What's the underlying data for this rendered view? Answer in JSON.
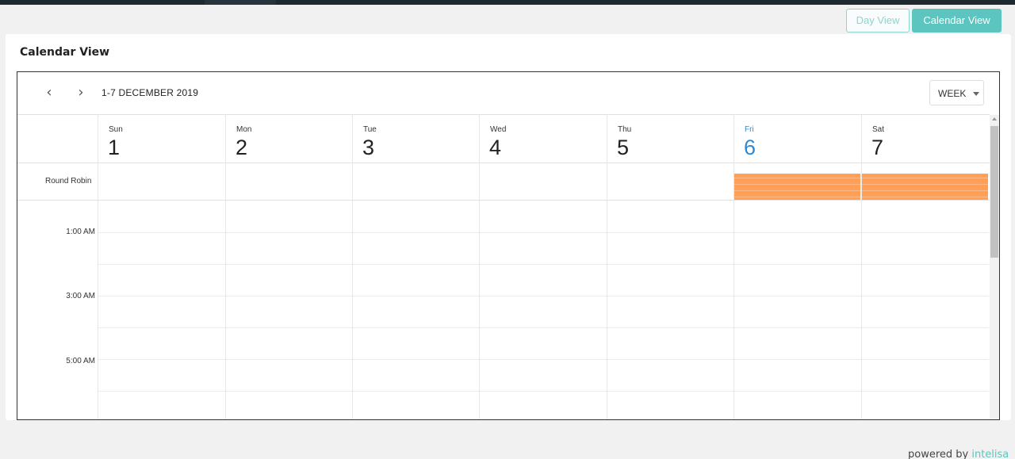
{
  "header": {
    "day_view_label": "Day View",
    "calendar_view_label": "Calendar View"
  },
  "card": {
    "title": "Calendar View"
  },
  "calendar": {
    "range_label": "1-7 DECEMBER 2019",
    "prev_icon": "chevron-left-icon",
    "next_icon": "chevron-right-icon",
    "view_mode": "WEEK",
    "days": [
      {
        "name": "Sun",
        "num": "1",
        "today": false
      },
      {
        "name": "Mon",
        "num": "2",
        "today": false
      },
      {
        "name": "Tue",
        "num": "3",
        "today": false
      },
      {
        "name": "Wed",
        "num": "4",
        "today": false
      },
      {
        "name": "Thu",
        "num": "5",
        "today": false
      },
      {
        "name": "Fri",
        "num": "6",
        "today": true
      },
      {
        "name": "Sat",
        "num": "7",
        "today": false
      }
    ],
    "resource_label": "Round Robin",
    "time_labels": [
      "1:00 AM",
      "3:00 AM",
      "5:00 AM"
    ],
    "event_color": "#ff9f58",
    "today_color": "#2b8bd6"
  },
  "footer": {
    "powered_prefix": "powered by ",
    "brand": "intelisa"
  }
}
